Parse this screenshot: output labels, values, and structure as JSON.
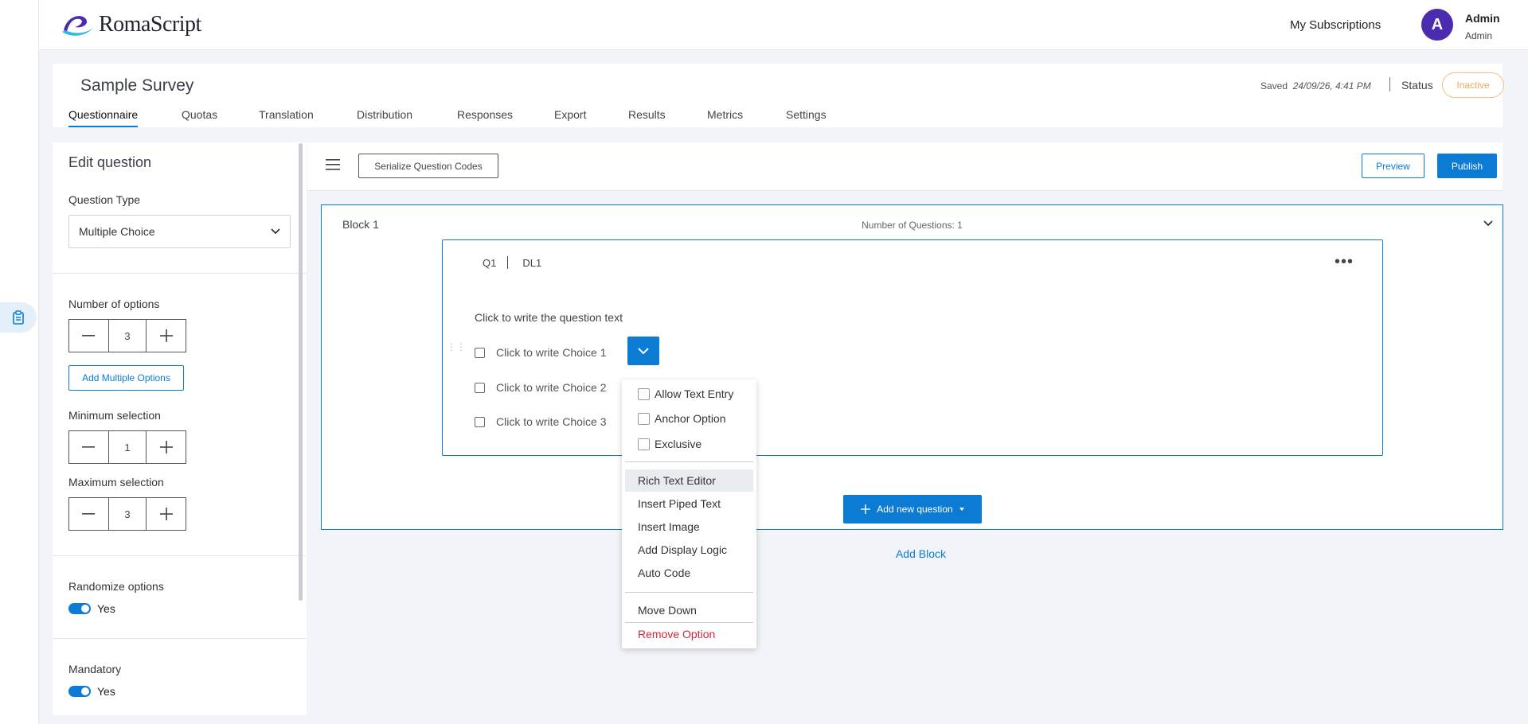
{
  "app": {
    "logo_text": "RomaScript",
    "my_subscriptions": "My Subscriptions",
    "user": {
      "avatar_letter": "A",
      "name": "Admin",
      "role": "Admin"
    }
  },
  "survey": {
    "title": "Sample Survey",
    "saved_label": "Saved",
    "saved_time": "24/09/26, 4:41 PM",
    "status_label": "Status",
    "status_value": "Inactive",
    "tabs": [
      {
        "label": "Questionnaire",
        "active": true
      },
      {
        "label": "Quotas"
      },
      {
        "label": "Translation"
      },
      {
        "label": "Distribution"
      },
      {
        "label": "Responses"
      },
      {
        "label": "Export"
      },
      {
        "label": "Results"
      },
      {
        "label": "Metrics"
      },
      {
        "label": "Settings"
      }
    ]
  },
  "edit_panel": {
    "title": "Edit question",
    "question_type_label": "Question Type",
    "question_type_value": "Multiple Choice",
    "num_options_label": "Number of options",
    "num_options_value": "3",
    "add_multiple_options": "Add Multiple Options",
    "min_selection_label": "Minimum selection",
    "min_selection_value": "1",
    "max_selection_label": "Maximum selection",
    "max_selection_value": "3",
    "randomize_label": "Randomize options",
    "randomize_value": "Yes",
    "mandatory_label": "Mandatory",
    "mandatory_value": "Yes"
  },
  "toolbar": {
    "serialize": "Serialize Question Codes",
    "preview": "Preview",
    "publish": "Publish"
  },
  "block": {
    "title": "Block 1",
    "count": "Number of Questions: 1",
    "question": {
      "code": "Q1",
      "label": "DL1",
      "text": "Click to write the question text",
      "choices": [
        "Click to write Choice 1",
        "Click to write Choice 2",
        "Click to write Choice 3"
      ]
    },
    "add_question": "Add new question",
    "add_block": "Add Block"
  },
  "choice_menu": {
    "checks": [
      "Allow Text Entry",
      "Anchor Option",
      "Exclusive"
    ],
    "items": [
      "Rich Text Editor",
      "Insert Piped Text",
      "Insert Image",
      "Add Display Logic",
      "Auto Code"
    ],
    "move_down": "Move Down",
    "remove": "Remove Option"
  },
  "colors": {
    "primary": "#0b7bd3",
    "avatar": "#4b2bb0",
    "inactive": "#f0a860",
    "danger": "#d1263c"
  }
}
